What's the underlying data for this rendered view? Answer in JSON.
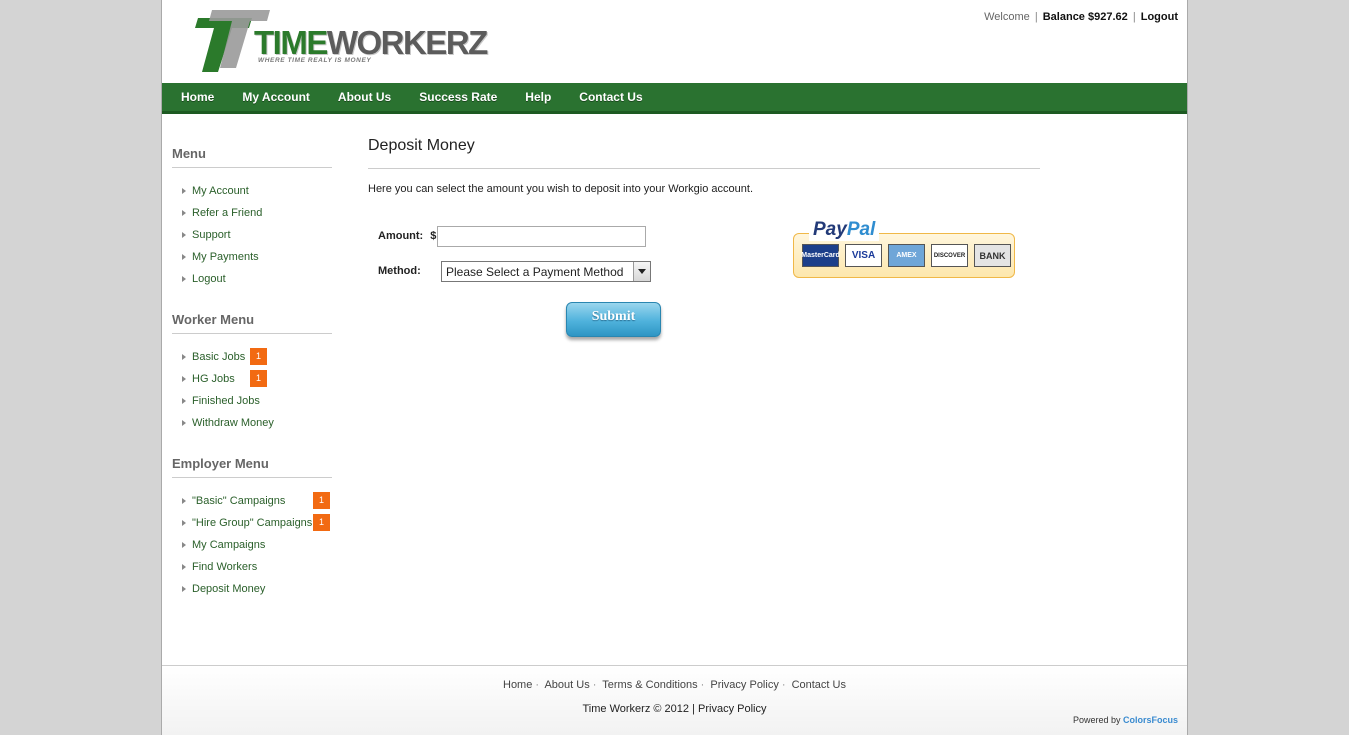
{
  "brand": {
    "name_first": "TIME",
    "name_rest": "WORKERZ",
    "tagline": "WHERE TIME REALY IS MONEY"
  },
  "topbar": {
    "welcome": "Welcome",
    "balance": "Balance $927.62",
    "logout": "Logout"
  },
  "nav": [
    "Home",
    "My Account",
    "About Us",
    "Success Rate",
    "Help",
    "Contact Us"
  ],
  "sidebar": {
    "menu": {
      "title": "Menu",
      "items": [
        "My Account",
        "Refer a Friend",
        "Support",
        "My Payments",
        "Logout"
      ]
    },
    "worker": {
      "title": "Worker Menu",
      "items": [
        {
          "label": "Basic Jobs",
          "badge": "1"
        },
        {
          "label": "HG Jobs",
          "badge": "1"
        },
        {
          "label": "Finished Jobs"
        },
        {
          "label": "Withdraw Money"
        }
      ]
    },
    "employer": {
      "title": "Employer Menu",
      "items": [
        {
          "label": "\"Basic\" Campaigns",
          "badge": "1"
        },
        {
          "label": "\"Hire Group\" Campaigns",
          "badge": "1"
        },
        {
          "label": "My Campaigns"
        },
        {
          "label": "Find Workers"
        },
        {
          "label": "Deposit Money"
        }
      ]
    }
  },
  "content": {
    "title": "Deposit Money",
    "intro": "Here you can select the amount you wish to deposit into your Workgio account.",
    "amount_label": "Amount:",
    "currency": "$",
    "amount_value": "",
    "method_label": "Method:",
    "method_selected": "Please Select a Payment Method",
    "submit_label": "Submit"
  },
  "paypal": {
    "word_pay": "Pay",
    "word_pal": "Pal",
    "cards": [
      "MasterCard",
      "VISA",
      "AMEX",
      "DISCOVER",
      "BANK"
    ]
  },
  "footer": {
    "links": [
      "Home",
      "About Us",
      "Terms & Conditions",
      "Privacy Policy",
      "Contact Us"
    ],
    "copyright": "Time Workerz © 2012",
    "privacy": "Privacy Policy",
    "powered_by": "Powered by",
    "powered_name": "ColorsFocus"
  },
  "colors": {
    "nav_green": "#2a7230",
    "badge_orange": "#f26a12",
    "link_green": "#2a5f2a"
  }
}
